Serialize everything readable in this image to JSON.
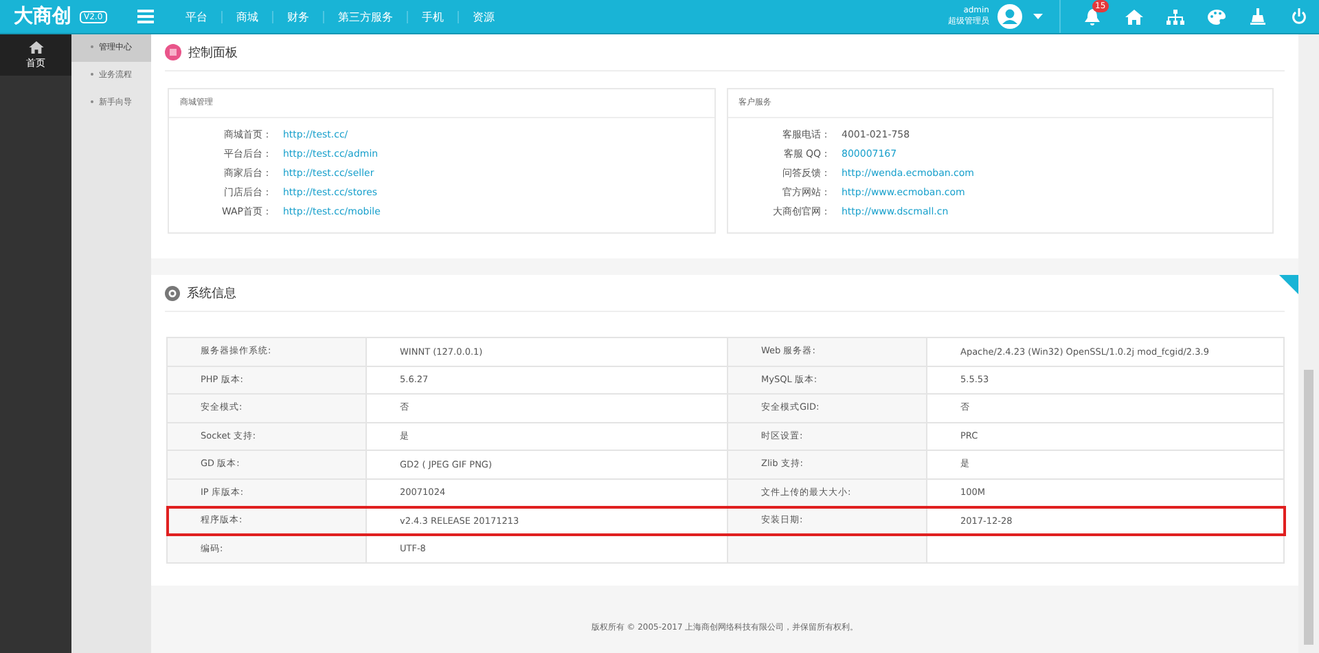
{
  "topbar": {
    "logo": "大商创",
    "version": "V2.0",
    "nav": [
      {
        "label": "平台"
      },
      {
        "label": "商城"
      },
      {
        "label": "财务"
      },
      {
        "label": "第三方服务"
      },
      {
        "label": "手机"
      },
      {
        "label": "资源"
      }
    ],
    "user": {
      "name": "admin",
      "role": "超级管理员"
    },
    "notification_count": "15"
  },
  "sidebar": {
    "items": [
      {
        "label": "首页",
        "selected": true
      }
    ]
  },
  "subnav": {
    "items": [
      {
        "label": "管理中心",
        "selected": true
      },
      {
        "label": "业务流程",
        "selected": false
      },
      {
        "label": "新手向导",
        "selected": false
      }
    ]
  },
  "control_panel": {
    "title": "控制面板",
    "boxes": [
      {
        "title": "商城管理",
        "rows": [
          {
            "label": "商城首页：",
            "value": "http://test.cc/",
            "kind": "link"
          },
          {
            "label": "平台后台：",
            "value": "http://test.cc/admin",
            "kind": "link"
          },
          {
            "label": "商家后台：",
            "value": "http://test.cc/seller",
            "kind": "link"
          },
          {
            "label": "门店后台：",
            "value": "http://test.cc/stores",
            "kind": "link"
          },
          {
            "label": "WAP首页：",
            "value": "http://test.cc/mobile",
            "kind": "link"
          }
        ]
      },
      {
        "title": "客户服务",
        "rows": [
          {
            "label": "客服电话：",
            "value": "4001-021-758",
            "kind": "text"
          },
          {
            "label": "客服 QQ：",
            "value": "800007167",
            "kind": "link"
          },
          {
            "label": "问答反馈：",
            "value": "http://wenda.ecmoban.com",
            "kind": "link"
          },
          {
            "label": "官方网站：",
            "value": "http://www.ecmoban.com",
            "kind": "link"
          },
          {
            "label": "大商创官网：",
            "value": "http://www.dscmall.cn",
            "kind": "link"
          }
        ]
      }
    ]
  },
  "system_info": {
    "title": "系统信息",
    "rows": [
      {
        "highlighted": false,
        "cells": [
          {
            "label": "服务器操作系统:",
            "value": "WINNT (127.0.0.1)"
          },
          {
            "label": "Web 服务器:",
            "value": "Apache/2.4.23 (Win32) OpenSSL/1.0.2j mod_fcgid/2.3.9"
          }
        ]
      },
      {
        "highlighted": false,
        "cells": [
          {
            "label": "PHP 版本:",
            "value": "5.6.27"
          },
          {
            "label": "MySQL 版本:",
            "value": "5.5.53"
          }
        ]
      },
      {
        "highlighted": false,
        "cells": [
          {
            "label": "安全模式:",
            "value": "否"
          },
          {
            "label": "安全模式GID:",
            "value": "否"
          }
        ]
      },
      {
        "highlighted": false,
        "cells": [
          {
            "label": "Socket 支持:",
            "value": "是"
          },
          {
            "label": "时区设置:",
            "value": "PRC"
          }
        ]
      },
      {
        "highlighted": false,
        "cells": [
          {
            "label": "GD 版本:",
            "value": "GD2 ( JPEG GIF PNG)"
          },
          {
            "label": "Zlib 支持:",
            "value": "是"
          }
        ]
      },
      {
        "highlighted": false,
        "cells": [
          {
            "label": "IP 库版本:",
            "value": "20071024"
          },
          {
            "label": "文件上传的最大大小:",
            "value": "100M"
          }
        ]
      },
      {
        "highlighted": true,
        "cells": [
          {
            "label": "程序版本:",
            "value": "v2.4.3 RELEASE 20171213"
          },
          {
            "label": "安装日期:",
            "value": "2017-12-28"
          }
        ]
      },
      {
        "highlighted": false,
        "cells": [
          {
            "label": "编码:",
            "value": "UTF-8"
          }
        ]
      }
    ]
  },
  "footer": "版权所有 © 2005-2017 上海商创网络科技有限公司，并保留所有权利。"
}
